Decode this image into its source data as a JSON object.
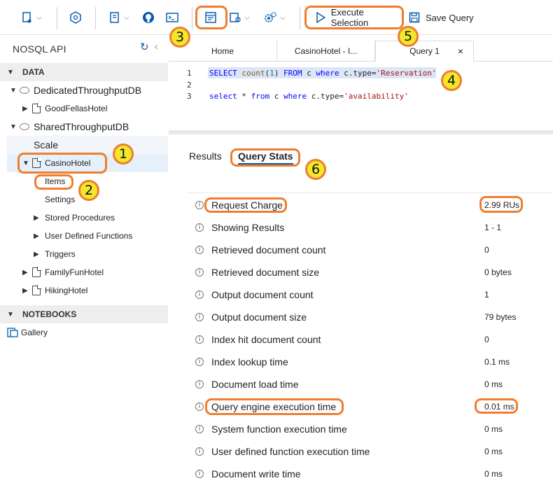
{
  "toolbar": {
    "execute_label": "Execute Selection",
    "save_label": "Save Query"
  },
  "sidebar": {
    "title": "NOSQL API",
    "data_section": "DATA",
    "notebooks_section": "NOTEBOOKS",
    "tree": {
      "db1": "DedicatedThroughputDB",
      "db1_child": "GoodFellasHotel",
      "db2": "SharedThroughputDB",
      "scale": "Scale",
      "casino": "CasinoHotel",
      "items": "Items",
      "settings": "Settings",
      "stored_procedures": "Stored Procedures",
      "udf": "User Defined Functions",
      "triggers": "Triggers",
      "family": "FamilyFunHotel",
      "hiking": "HikingHotel"
    },
    "gallery": "Gallery"
  },
  "tabs": [
    {
      "label": "Home"
    },
    {
      "label": "CasinoHotel - I..."
    },
    {
      "label": "Query 1"
    }
  ],
  "tab_close": "×",
  "editor": {
    "line_numbers": [
      "1",
      "2",
      "3"
    ],
    "line1": {
      "select": "SELECT",
      "count": "count",
      "open": "(",
      "one": "1",
      "close": ")",
      "from": "FROM",
      "c": " c ",
      "where": "where",
      "rest": " c.type=",
      "str": "'Reservation'"
    },
    "line3": {
      "select": "select",
      "star": " * ",
      "from": "from",
      "c": " c ",
      "where": "where",
      "rest": " c.type=",
      "str": "'availability'"
    }
  },
  "results": {
    "tab_results": "Results",
    "tab_stats": "Query Stats"
  },
  "stats": [
    {
      "name": "Request Charge",
      "value": "2.99 RUs"
    },
    {
      "name": "Showing Results",
      "value": "1 - 1"
    },
    {
      "name": "Retrieved document count",
      "value": "0"
    },
    {
      "name": "Retrieved document size",
      "value": "0 bytes"
    },
    {
      "name": "Output document count",
      "value": "1"
    },
    {
      "name": "Output document size",
      "value": "79 bytes"
    },
    {
      "name": "Index hit document count",
      "value": "0"
    },
    {
      "name": "Index lookup time",
      "value": "0.1 ms"
    },
    {
      "name": "Document load time",
      "value": "0 ms"
    },
    {
      "name": "Query engine execution time",
      "value": "0.01 ms"
    },
    {
      "name": "System function execution time",
      "value": "0 ms"
    },
    {
      "name": "User defined function execution time",
      "value": "0 ms"
    },
    {
      "name": "Document write time",
      "value": "0 ms"
    }
  ],
  "badges": [
    "1",
    "2",
    "3",
    "4",
    "5",
    "6"
  ],
  "colors": {
    "highlight": "#ee7e2f",
    "badge": "#f3e72b",
    "accent": "#0b5cab"
  }
}
